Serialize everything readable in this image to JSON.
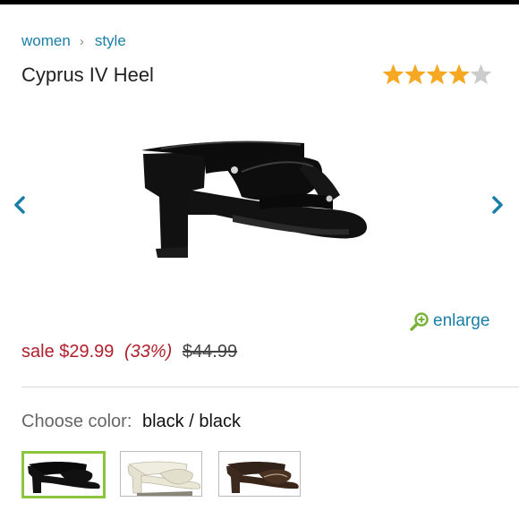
{
  "breadcrumb": {
    "items": [
      "women",
      "style"
    ],
    "separator": "›"
  },
  "product": {
    "title": "Cyprus IV Heel",
    "rating": 4,
    "rating_max": 5
  },
  "gallery": {
    "prev_icon": "chevron-left-icon",
    "next_icon": "chevron-right-icon"
  },
  "enlarge": {
    "label": "enlarge",
    "icon": "zoom-in-icon"
  },
  "price": {
    "sale_label": "sale $29.99",
    "discount": "(33%)",
    "original": "$44.99"
  },
  "color": {
    "label": "Choose color:",
    "selected_value": "black / black",
    "swatches": [
      "black",
      "cream",
      "brown"
    ]
  },
  "colors": {
    "link": "#1a7fa8",
    "sale": "#b0202c",
    "star": "#f6a823",
    "selected_border": "#8cc63f"
  }
}
